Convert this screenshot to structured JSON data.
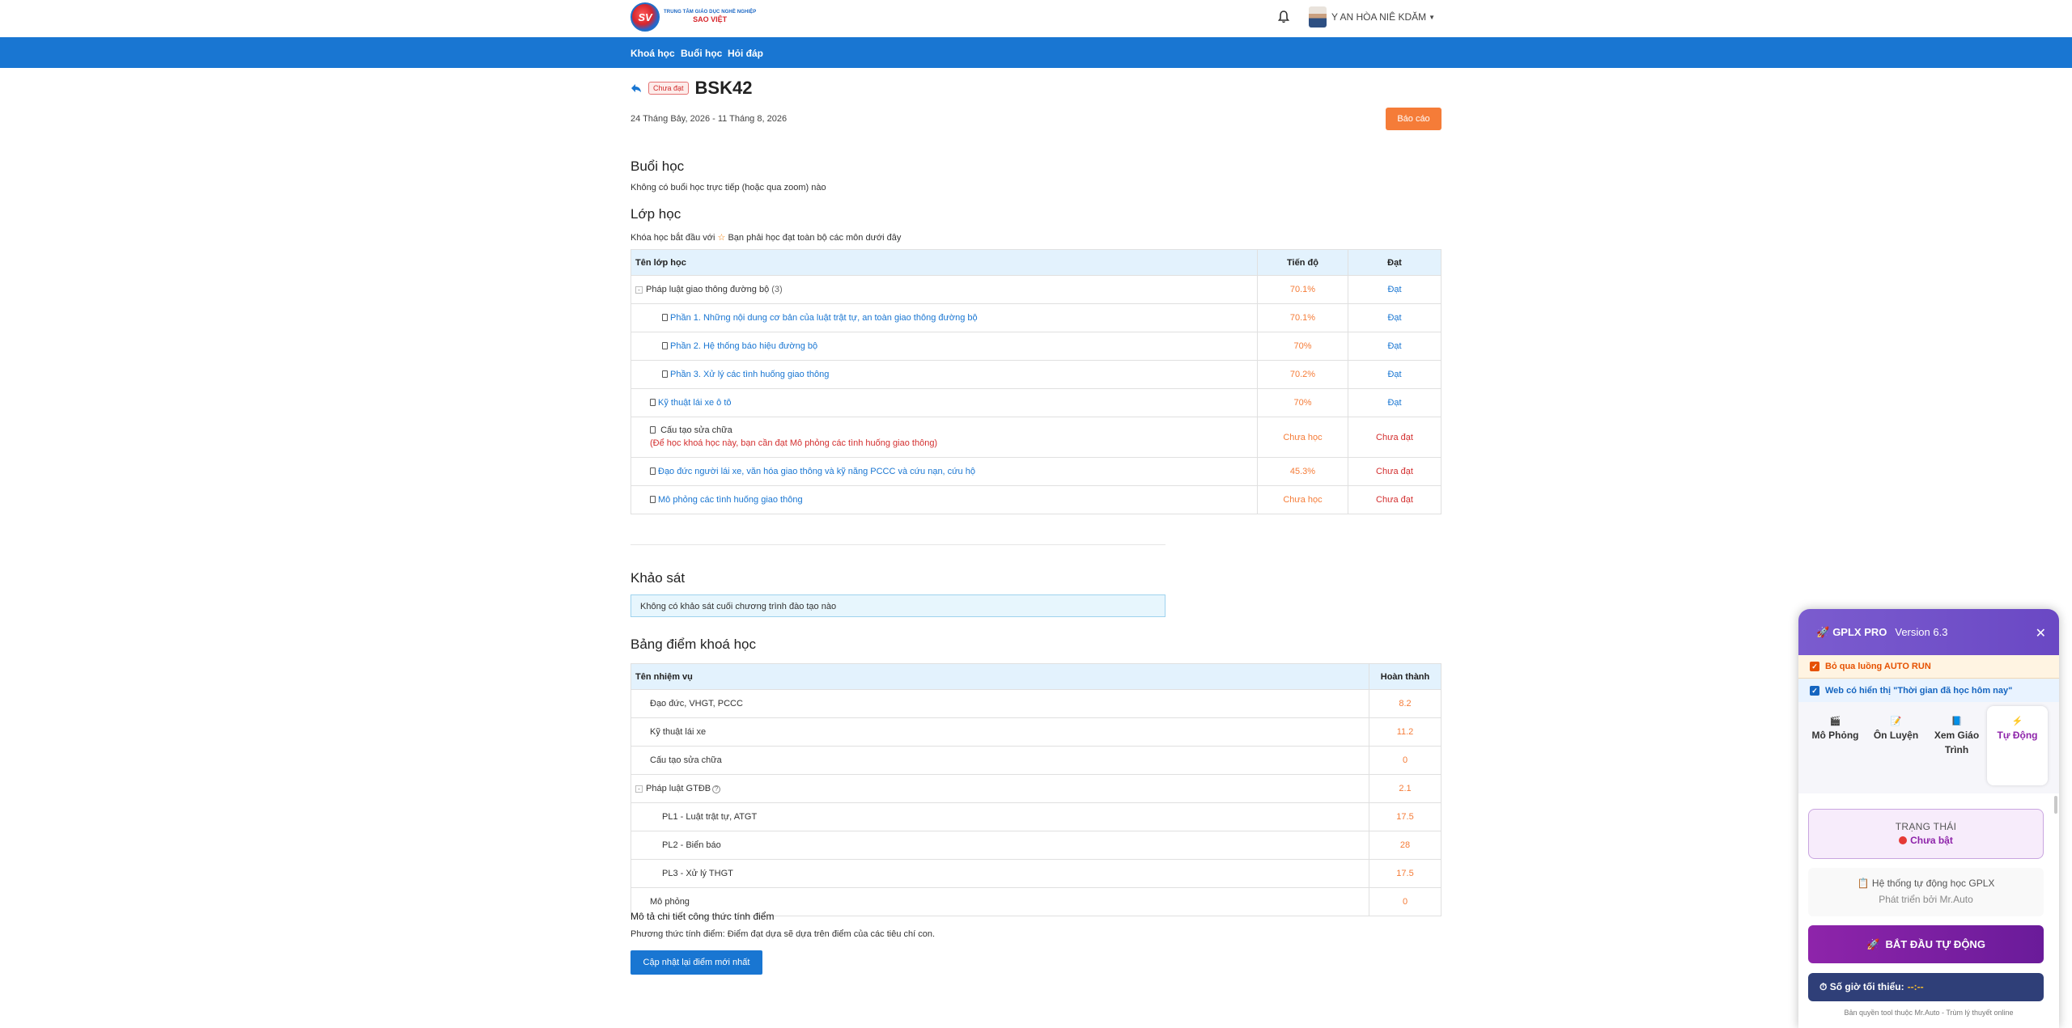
{
  "header": {
    "logo_monogram": "SV",
    "logo_line1": "TRUNG TÂM GIÁO DỤC NGHỀ NGHIỆP",
    "logo_line2": "SAO VIỆT",
    "user_name": "Y AN HÒA NIÊ KDĂM"
  },
  "nav": {
    "items": [
      "Khoá học",
      "Buổi học",
      "Hỏi đáp"
    ]
  },
  "course": {
    "status_badge": "Chưa đạt",
    "title": "BSK42",
    "dates": "24 Tháng Bảy, 2026 - 11 Tháng 8, 2026",
    "report_label": "Báo cáo"
  },
  "sessions": {
    "heading": "Buổi học",
    "empty_text": "Không có buổi học trực tiếp (hoặc qua zoom) nào"
  },
  "classes": {
    "heading": "Lớp học",
    "intro_before": "Khóa học bắt đầu với",
    "intro_star": "☆",
    "intro_after": "Bạn phải học đạt toàn bộ các môn dưới đây",
    "columns": [
      "Tên lớp học",
      "Tiến độ",
      "Đạt"
    ],
    "rows": [
      {
        "toggle": "-",
        "name": "Pháp luật giao thông đường bộ",
        "count": "(3)",
        "progress": "70.1%",
        "result": "Đạt"
      },
      {
        "name": "Phần 1. Những nội dung cơ bản của luật trật tự, an toàn giao thông đường bộ",
        "progress": "70.1%",
        "result": "Đạt"
      },
      {
        "name": "Phần 2. Hệ thống báo hiệu đường bộ",
        "progress": "70%",
        "result": "Đạt"
      },
      {
        "name": "Phần 3. Xử lý các tình huống giao thông",
        "progress": "70.2%",
        "result": "Đạt"
      },
      {
        "name": "Kỹ thuật lái xe ô tô",
        "progress": "70%",
        "result": "Đạt"
      },
      {
        "name": "Cấu tạo sửa chữa",
        "note": "(Để học khoá học này, bạn cần đạt Mô phỏng các tình huống giao thông)",
        "progress": "Chưa học",
        "result": "Chưa đạt"
      },
      {
        "name": "Đạo đức người lái xe, văn hóa giao thông và kỹ năng PCCC và cứu nạn, cứu hộ",
        "progress": "45.3%",
        "result": "Chưa đạt"
      },
      {
        "name": "Mô phỏng các tình huống giao thông",
        "progress": "Chưa học",
        "result": "Chưa đạt"
      }
    ]
  },
  "survey": {
    "heading": "Khảo sát",
    "empty_text": "Không có khảo sát cuối chương trình đào tạo nào"
  },
  "scores": {
    "heading": "Bảng điểm khoá học",
    "columns": [
      "Tên nhiệm vụ",
      "Hoàn thành"
    ],
    "rows": [
      {
        "name": "Đạo đức, VHGT, PCCC",
        "value": "8.2"
      },
      {
        "name": "Kỹ thuật lái xe",
        "value": "11.2"
      },
      {
        "name": "Cấu tạo sửa chữa",
        "value": "0"
      },
      {
        "toggle": "-",
        "name": "Pháp luật GTĐB",
        "help": "?",
        "value": "2.1"
      },
      {
        "name": "PL1 - Luật trật tự, ATGT",
        "value": "17.5"
      },
      {
        "name": "PL2 - Biển báo",
        "value": "28"
      },
      {
        "name": "PL3 - Xử lý THGT",
        "value": "17.5"
      },
      {
        "name": "Mô phỏng",
        "value": "0"
      }
    ],
    "formula_title": "Mô tả chi tiết công thức tính điểm",
    "formula_text": "Phương thức tính điểm: Điểm đạt dựa sẽ dựa trên điểm của các tiêu chí con.",
    "update_label": "Cập nhật lại điểm mới nhất"
  },
  "gplx": {
    "brand": "GPLX PRO",
    "version": "Version 6.3",
    "close": "✕",
    "option1": "Bỏ qua luồng AUTO RUN",
    "option2": "Web có hiển thị \"Thời gian đã học hôm nay\"",
    "tabs": [
      {
        "label": "Mô Phỏng",
        "icon": "🎬"
      },
      {
        "label": "Ôn Luyện",
        "icon": "📝"
      },
      {
        "label": "Xem Giáo Trình",
        "icon": "📘"
      },
      {
        "label": "Tự Động",
        "icon": "⚡"
      }
    ],
    "status_label": "TRẠNG THÁI",
    "status_value": "Chưa bật",
    "system_title": "Hệ thống tự động học GPLX",
    "system_sub": "Phát triển bởi Mr.Auto",
    "start_label": "BẮT ĐẦU TỰ ĐỘNG",
    "hours_label": "Số giờ tối thiểu:",
    "hours_value": "--:--",
    "copyright": "Bản quyền tool thuộc Mr.Auto - Trùm lý thuyết online"
  },
  "colors": {
    "nav": "#1976d2",
    "accent_orange": "#f57c38",
    "fail_red": "#d32f2f",
    "purple": "#8e24aa"
  }
}
